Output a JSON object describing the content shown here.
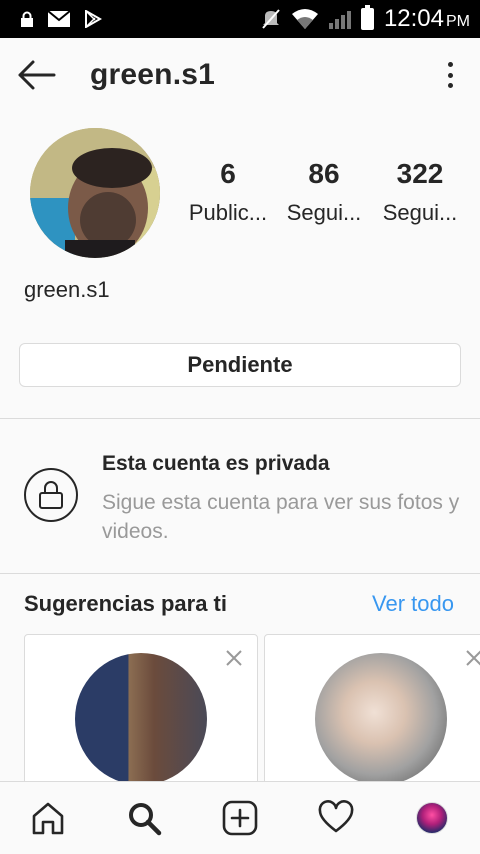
{
  "status_bar": {
    "time": "12:04",
    "ampm": "PM",
    "icons": [
      "lock-icon",
      "mail-icon",
      "play-store-icon",
      "mute-icon",
      "wifi-icon",
      "signal-icon",
      "battery-icon"
    ]
  },
  "header": {
    "title": "green.s1",
    "back_icon": "arrow-left-icon",
    "menu_icon": "kebab-menu-icon"
  },
  "profile": {
    "username": "green.s1",
    "stats": [
      {
        "value": "6",
        "label": "Public..."
      },
      {
        "value": "86",
        "label": "Segui..."
      },
      {
        "value": "322",
        "label": "Segui..."
      }
    ],
    "pending_label": "Pendiente"
  },
  "private": {
    "title": "Esta cuenta es privada",
    "subtitle": "Sigue esta cuenta para ver sus fotos y videos."
  },
  "suggestions": {
    "title": "Sugerencias para ti",
    "see_all": "Ver todo"
  },
  "bottom_nav": {
    "items": [
      "home-icon",
      "search-icon",
      "add-post-icon",
      "activity-heart-icon",
      "profile-avatar"
    ]
  },
  "colors": {
    "link_blue": "#3897f0",
    "text": "#262626",
    "muted": "#999999",
    "border": "#dbdbdb",
    "background": "#fafafa"
  }
}
